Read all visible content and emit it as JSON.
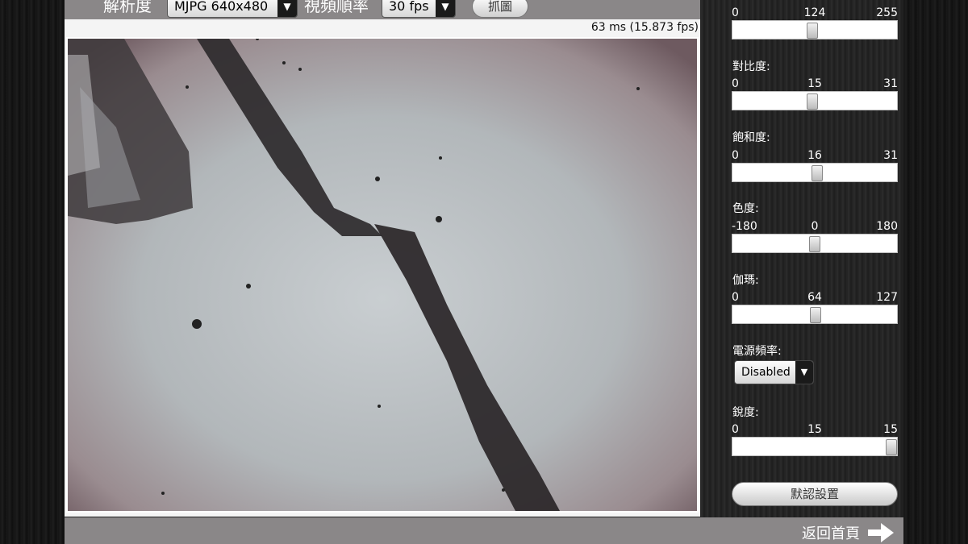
{
  "toolbar": {
    "resolution_label": "解析度",
    "resolution_value": "MJPG 640x480",
    "framerate_label": "視頻順率",
    "framerate_value": "30 fps",
    "capture_label": "抓圖"
  },
  "status": {
    "frame_time": "63 ms (15.873 fps)"
  },
  "controls": {
    "brightness": {
      "min": "0",
      "value": "124",
      "max": "255",
      "level": 124
    },
    "contrast": {
      "label": "對比度:",
      "min": "0",
      "value": "15",
      "max": "31",
      "level": 15
    },
    "saturation": {
      "label": "飽和度:",
      "min": "0",
      "value": "16",
      "max": "31",
      "level": 16
    },
    "hue": {
      "label": "色度:",
      "min": "-180",
      "value": "0",
      "max": "180",
      "level": 0
    },
    "gamma": {
      "label": "伽瑪:",
      "min": "0",
      "value": "64",
      "max": "127",
      "level": 64
    },
    "power_frequency": {
      "label": "電源頻率:",
      "value": "Disabled"
    },
    "sharpness": {
      "label": "銳度:",
      "min": "0",
      "value": "15",
      "max": "15",
      "level": 15
    },
    "reset_label": "默認設置"
  },
  "footer": {
    "back_label": "返回首頁"
  },
  "icons": {
    "dropdown": "chevron-down-icon",
    "back": "arrow-right-icon"
  }
}
